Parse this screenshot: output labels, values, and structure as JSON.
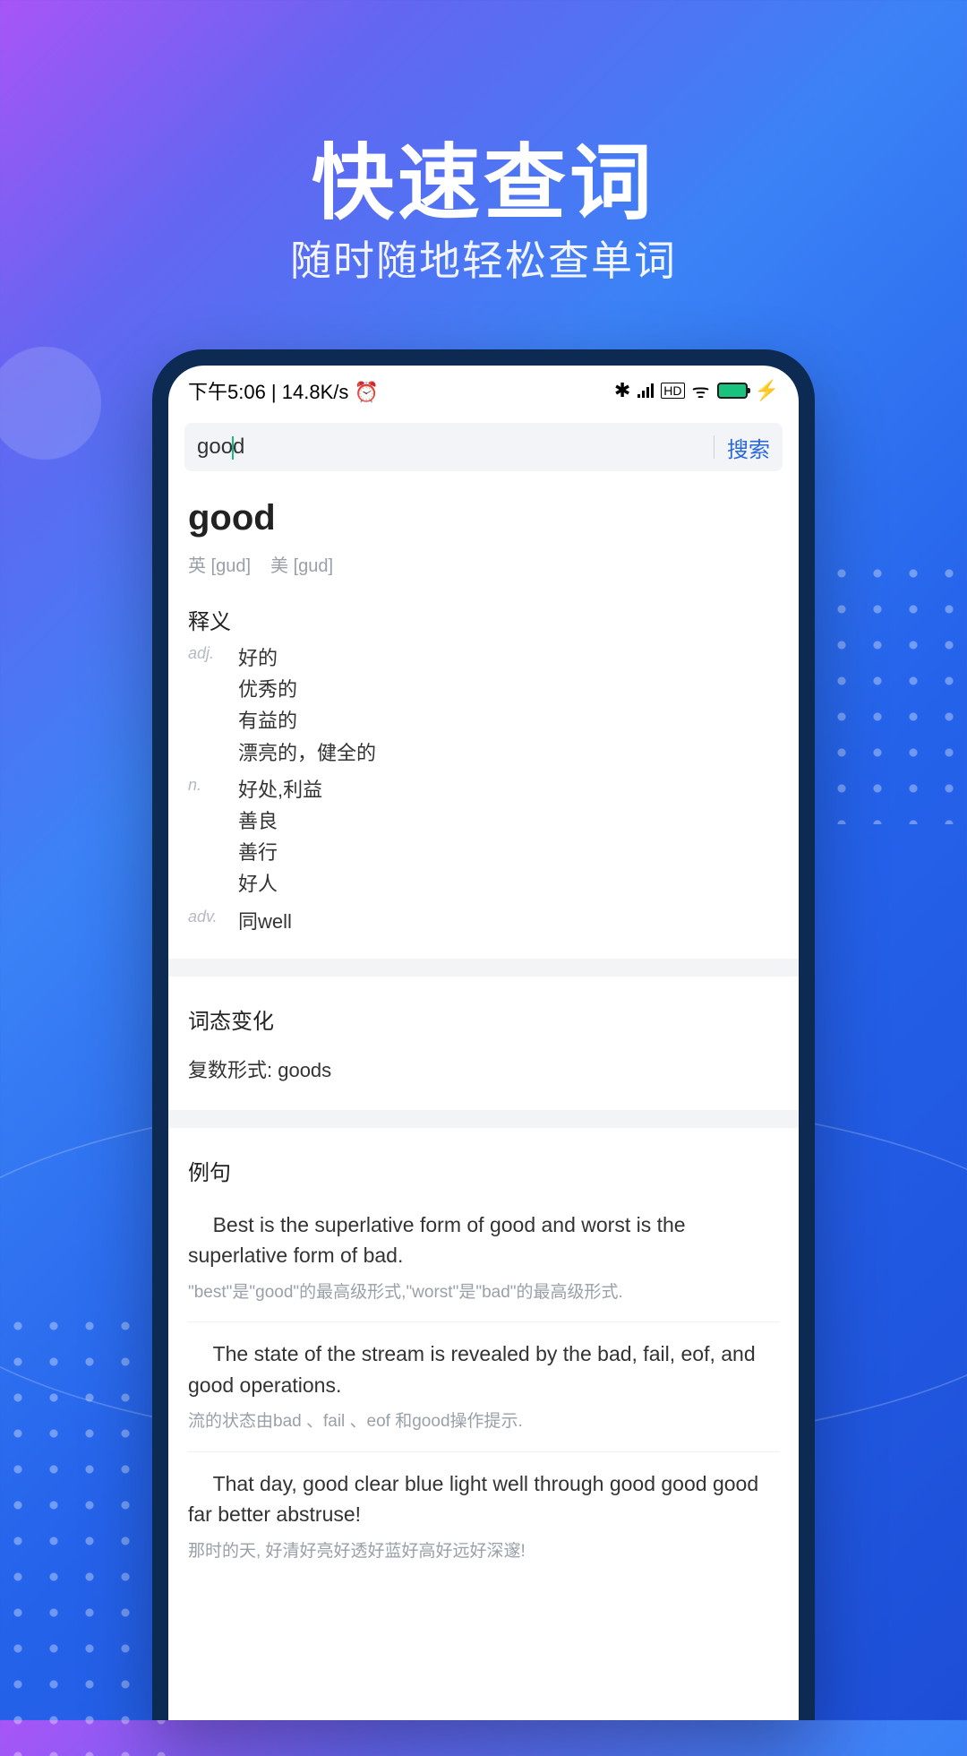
{
  "promo": {
    "title": "快速查词",
    "subtitle": "随时随地轻松查单词"
  },
  "status_bar": {
    "time_net": "下午5:06 | 14.8K/s",
    "alarm_icon": "⏰",
    "bluetooth_icon": "✱",
    "hd_label": "HD",
    "rss_icon": "ᯤ",
    "battery_label": "100",
    "charge_icon": "⚡"
  },
  "search": {
    "prefix": "goo",
    "suffix": "d",
    "button": "搜索"
  },
  "entry": {
    "word": "good",
    "ipa_uk": "英 [gud]",
    "ipa_us": "美 [gud]"
  },
  "definitions": {
    "title": "释义",
    "rows": [
      {
        "pos": "adj.",
        "meanings": [
          "好的",
          "优秀的",
          "有益的",
          "漂亮的，健全的"
        ]
      },
      {
        "pos": "n.",
        "meanings": [
          "好处,利益",
          "善良",
          "善行",
          "好人"
        ]
      },
      {
        "pos": "adv.",
        "meanings": [
          "同well"
        ]
      }
    ]
  },
  "inflection": {
    "title": "词态变化",
    "body": "复数形式: goods"
  },
  "examples": {
    "title": "例句",
    "items": [
      {
        "en": "Best is the superlative form of good and worst is the superlative form of bad.",
        "zh": "\"best\"是\"good\"的最高级形式,\"worst\"是\"bad\"的最高级形式."
      },
      {
        "en": "The state of the stream is revealed by the bad, fail, eof, and good operations.",
        "zh": "流的状态由bad 、fail 、eof 和good操作提示."
      },
      {
        "en": "That day, good clear blue light well through good good good far better abstruse!",
        "zh": "那时的天, 好清好亮好透好蓝好高好远好深邃!"
      }
    ]
  }
}
